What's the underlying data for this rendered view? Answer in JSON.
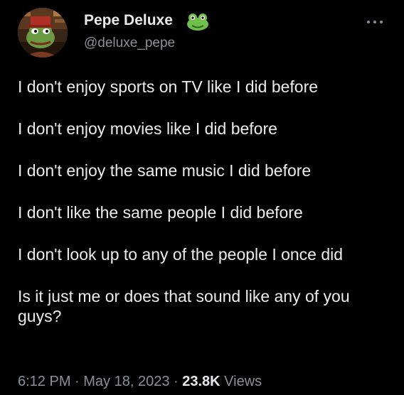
{
  "author": {
    "display_name": "Pepe Deluxe",
    "handle": "@deluxe_pepe",
    "avatar_icon": "pepe-frog-avatar",
    "badge_icon": "frog-face-emoji"
  },
  "header": {
    "more_icon": "more-options-icon"
  },
  "tweet": {
    "paragraphs": [
      "I don't enjoy sports on TV like I did before",
      "I don't enjoy movies like I did before",
      "I don't enjoy the same music I did before",
      "I don't like the same people I did before",
      "I don't look up to any of the people I once did",
      "Is it just me or does that sound like any of you guys?"
    ]
  },
  "meta": {
    "time": "6:12 PM",
    "separator1": " · ",
    "date": "May 18, 2023",
    "separator2": " · ",
    "views_count": "23.8K",
    "views_label": " Views"
  },
  "colors": {
    "background": "#000000",
    "text_primary": "#e7e9ea",
    "text_secondary": "#8b9096",
    "frog_green": "#6fbf4a"
  }
}
